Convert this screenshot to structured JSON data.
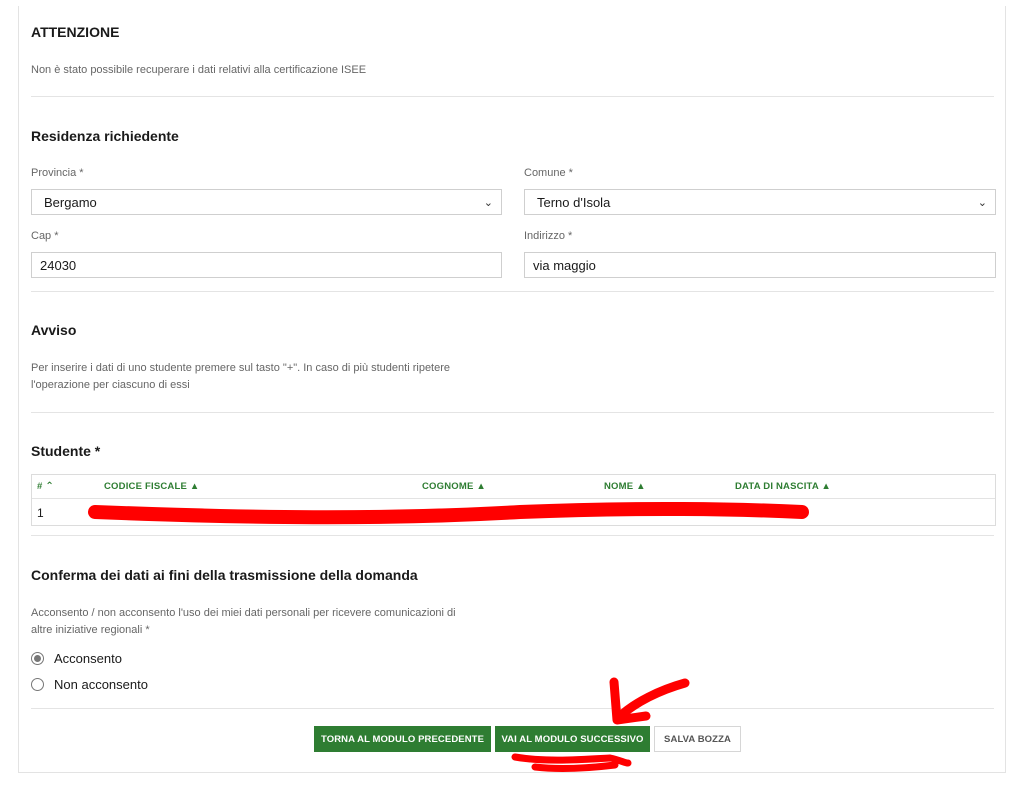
{
  "attention": {
    "title": "ATTENZIONE",
    "message": "Non è stato possibile recuperare i dati relativi alla certificazione ISEE"
  },
  "residence": {
    "title": "Residenza richiedente",
    "provincia_label": "Provincia *",
    "provincia_value": "Bergamo",
    "comune_label": "Comune *",
    "comune_value": "Terno d'Isola",
    "cap_label": "Cap *",
    "cap_value": "24030",
    "indirizzo_label": "Indirizzo *",
    "indirizzo_value": "via maggio"
  },
  "notice": {
    "title": "Avviso",
    "line1": "Per inserire i dati di uno studente premere sul tasto \"+\". In caso di più studenti ripetere",
    "line2": "l'operazione per ciascuno di essi"
  },
  "student": {
    "title": "Studente *",
    "columns": [
      "#",
      "CODICE FISCALE",
      "COGNOME",
      "NOME",
      "DATA DI NASCITA"
    ],
    "rows": [
      {
        "index": "1"
      }
    ]
  },
  "consent": {
    "title": "Conferma dei dati ai fini della trasmissione della domanda",
    "question_line1": "Acconsento / non acconsento l'uso dei miei dati personali per ricevere comunicazioni di",
    "question_line2": "altre iniziative regionali *",
    "options": [
      {
        "label": "Acconsento",
        "selected": true
      },
      {
        "label": "Non acconsento",
        "selected": false
      }
    ]
  },
  "actions": {
    "prev": "TORNA AL MODULO PRECEDENTE",
    "next": "VAI AL MODULO SUCCESSIVO",
    "draft": "SALVA BOZZA"
  },
  "colors": {
    "accent_green": "#2e7d32",
    "annotation_red": "#ff0000"
  },
  "icons": {
    "sort_asc": "chevron-up-icon",
    "sort": "sort-icon",
    "select": "chevron-down-icon"
  }
}
